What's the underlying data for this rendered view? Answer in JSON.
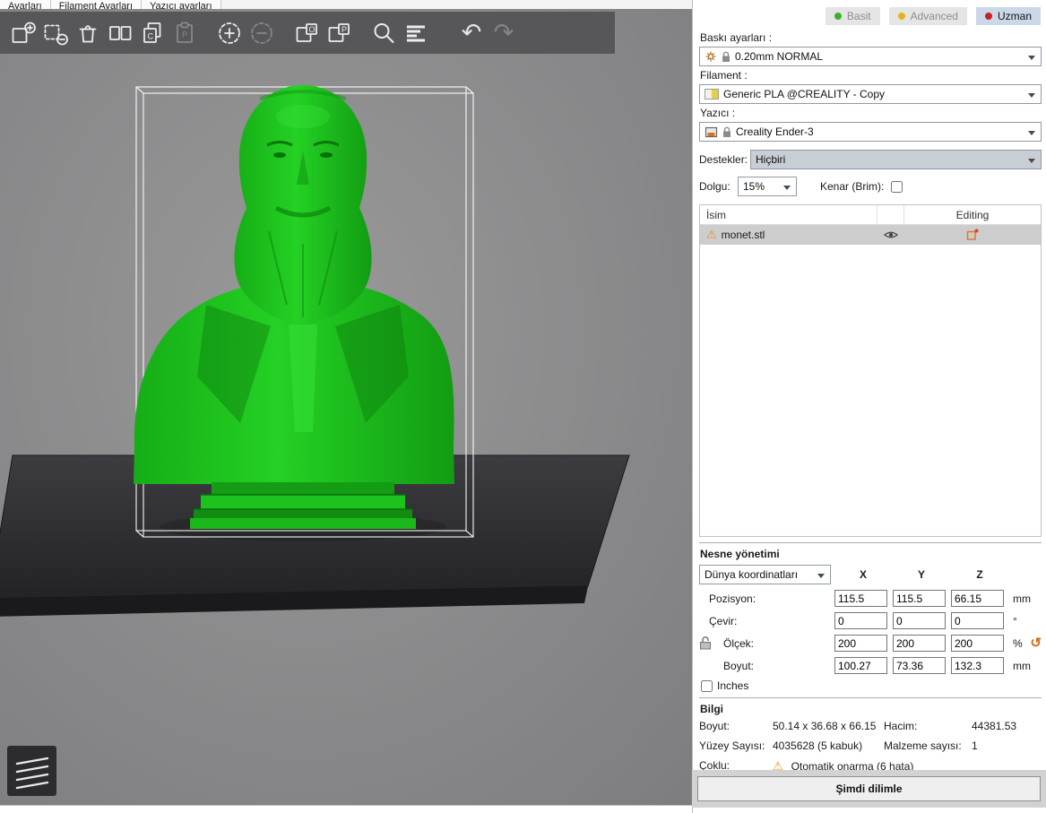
{
  "menu_tabs": [
    "Ayarları",
    "Filament Ayarları",
    "Yazıcı ayarları"
  ],
  "toolbar_icons": [
    "add-object",
    "remove-object",
    "delete-all",
    "arrange",
    "copy",
    "paste",
    "add-instance",
    "remove-instance",
    "split-to-objects",
    "split-to-parts",
    "search",
    "variable-layer-height",
    "undo",
    "redo"
  ],
  "modes": {
    "simple": "Basit",
    "advanced": "Advanced",
    "expert": "Uzman",
    "selected": "Uzman"
  },
  "mode_colors": {
    "simple_dot": "#3fae2a",
    "advanced_dot": "#e3b41e",
    "expert_dot": "#cc1f1f",
    "selected_bg": "#cbd8e8"
  },
  "print_settings": {
    "label": "Baskı ayarları :",
    "value": "0.20mm NORMAL"
  },
  "filament": {
    "label": "Filament :",
    "value": "Generic PLA @CREALITY - Copy"
  },
  "printer": {
    "label": "Yazıcı :",
    "value": "Creality Ender-3"
  },
  "supports": {
    "label": "Destekler:",
    "value": "Hiçbiri"
  },
  "infill": {
    "label": "Dolgu:",
    "value": "15%"
  },
  "brim": {
    "label": "Kenar (Brim):",
    "checked": false
  },
  "object_list": {
    "name_col": "İsim",
    "editing_col": "Editing",
    "rows": [
      {
        "name": "monet.stl",
        "warning": true,
        "warning_icon": "⚠"
      }
    ]
  },
  "manipulation": {
    "title": "Nesne yönetimi",
    "coord_system": "Dünya koordinatları",
    "axis_x": "X",
    "axis_y": "Y",
    "axis_z": "Z",
    "rows": [
      {
        "label": "Pozisyon:",
        "x": "115.5",
        "y": "115.5",
        "z": "66.15",
        "unit": "mm"
      },
      {
        "label": "Çevir:",
        "x": "0",
        "y": "0",
        "z": "0",
        "unit": "°"
      },
      {
        "label": "Ölçek:",
        "x": "200",
        "y": "200",
        "z": "200",
        "unit": "%"
      },
      {
        "label": "Boyut:",
        "x": "100.27",
        "y": "73.36",
        "z": "132.3",
        "unit": "mm"
      }
    ],
    "reset_icon": "↺",
    "inches_label": "Inches",
    "inches_checked": false
  },
  "info": {
    "title": "Bilgi",
    "size_label": "Boyut:",
    "size_value": "50.14 x 36.68 x 66.15",
    "volume_label": "Hacim:",
    "volume_value": "44381.53",
    "facets_label": "Yüzey Sayısı:",
    "facets_value": "4035628 (5 kabuk)",
    "materials_label": "Malzeme sayısı:",
    "materials_value": "1",
    "manifold_label": "Çoklu:",
    "manifold_icon": "⚠",
    "manifold_value": "Otomatik onarma (6 hata)"
  },
  "slice_button_label": "Şimdi dilimle",
  "undo_glyph": "↶",
  "redo_glyph": "↷",
  "scene": {
    "model_file": "monet.stl",
    "model_color": "#1fc51f",
    "bed_color": "#2b2b2e",
    "background_color": "#8a8a8c",
    "selection_box_color": "#ffffff"
  }
}
